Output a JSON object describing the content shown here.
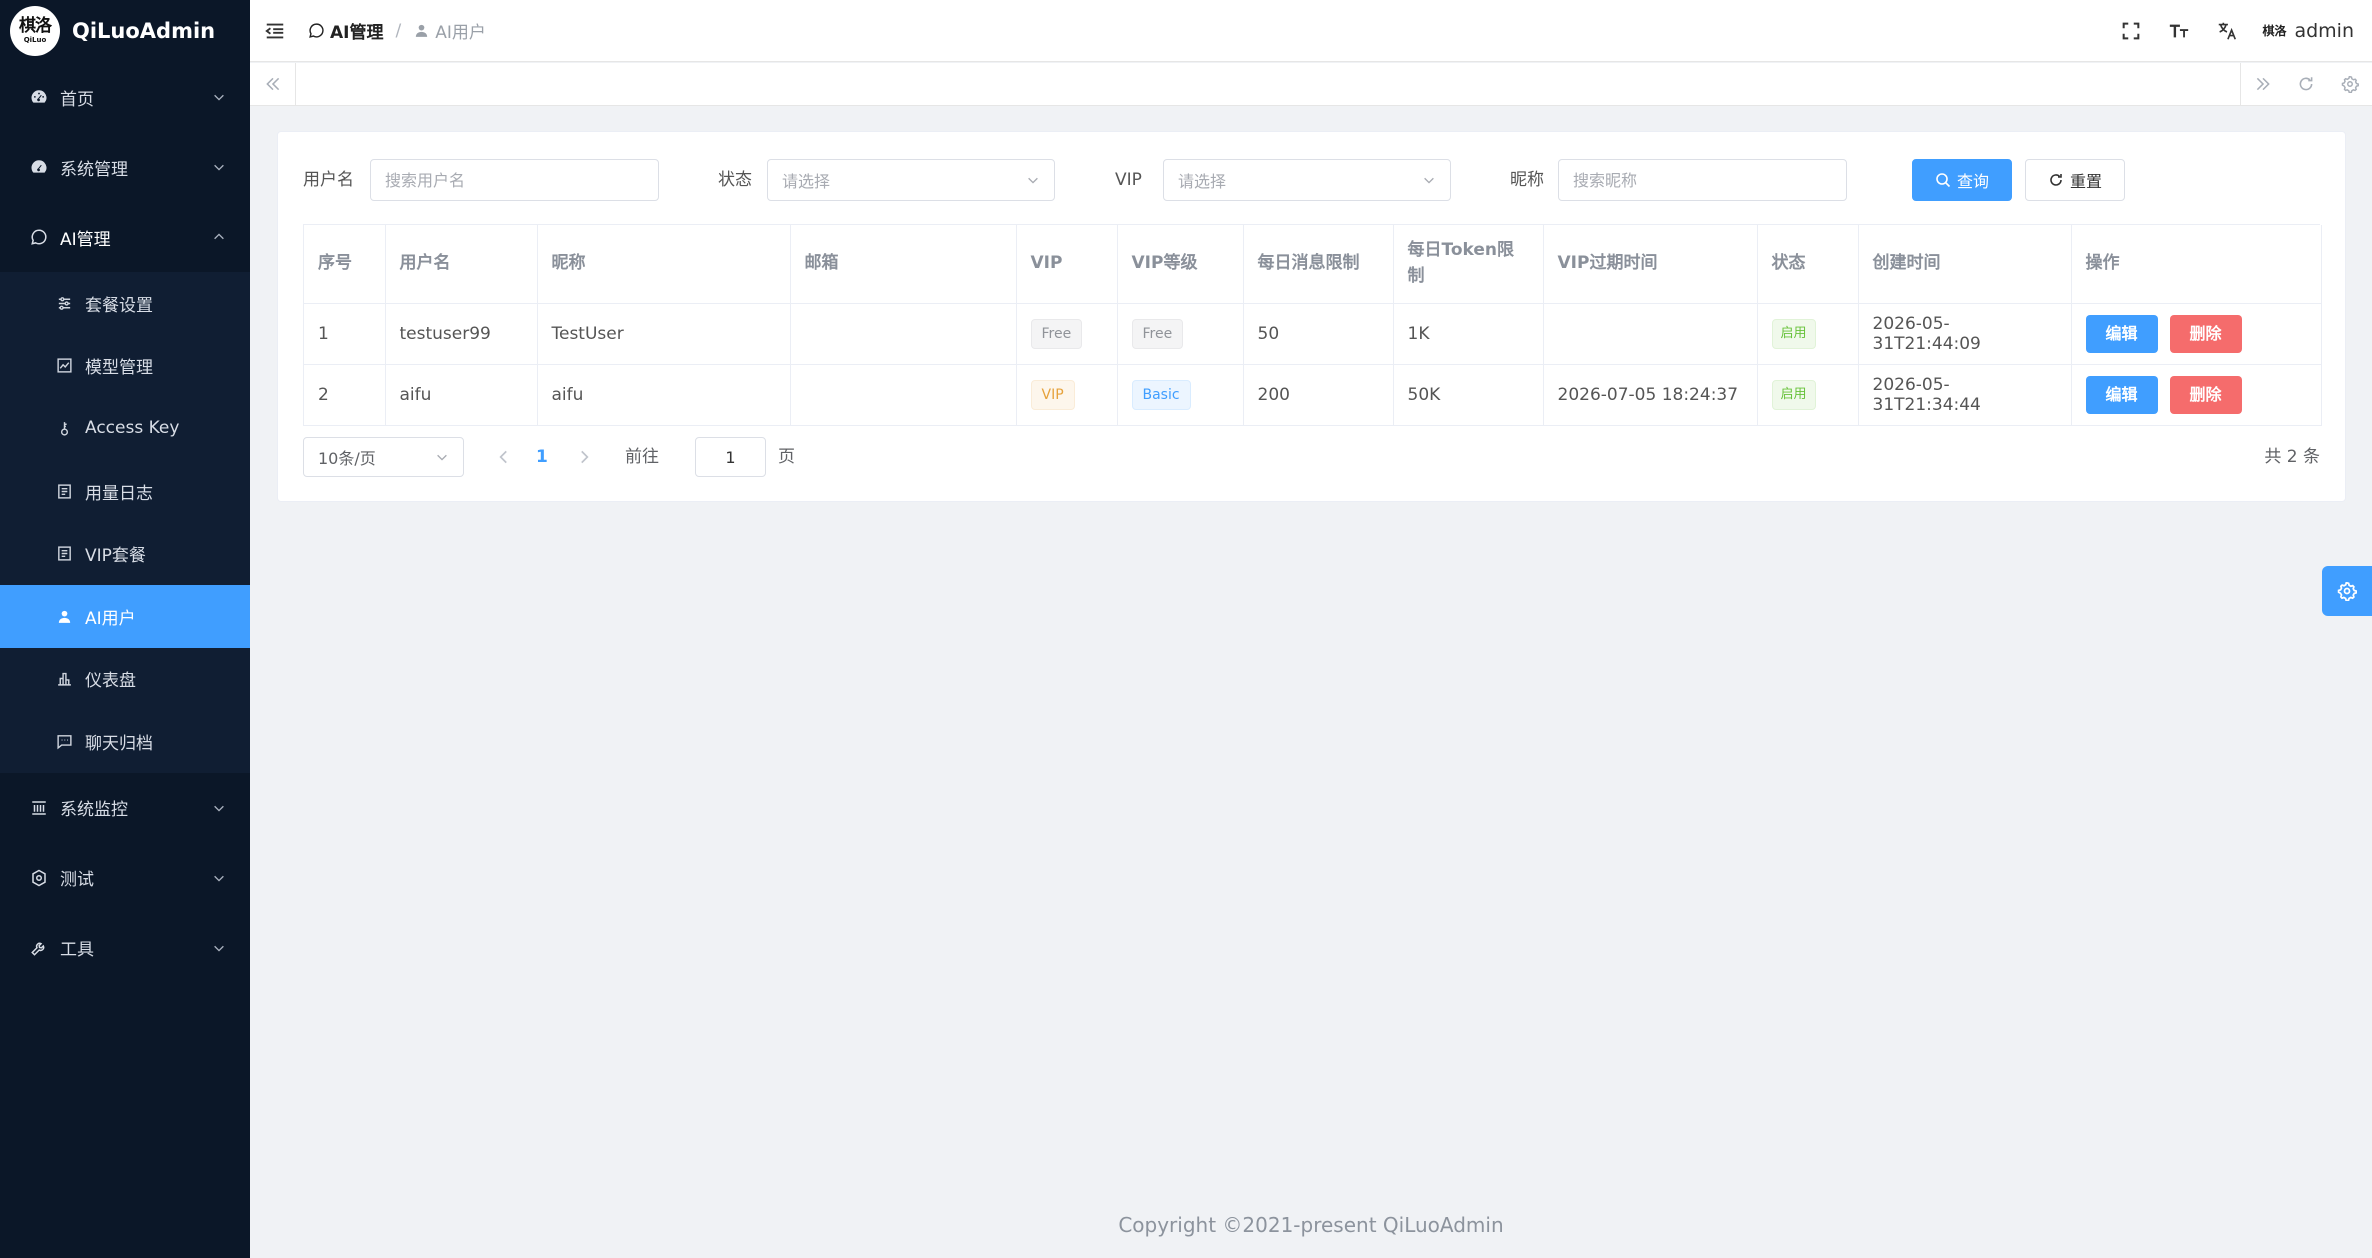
{
  "app": {
    "logo_main": "棋洛",
    "logo_sub": "QiLuo",
    "title": "QiLuoAdmin"
  },
  "sidebar": {
    "items": [
      {
        "label": "首页",
        "icon": "dashboard-icon"
      },
      {
        "label": "系统管理",
        "icon": "gauge-icon"
      },
      {
        "label": "AI管理",
        "icon": "chat-bubble-icon"
      },
      {
        "label": "系统监控",
        "icon": "monitor-icon"
      },
      {
        "label": "测试",
        "icon": "shield-icon"
      },
      {
        "label": "工具",
        "icon": "tools-icon"
      }
    ],
    "ai_submenu": [
      {
        "label": "套餐设置",
        "icon": "sliders-icon"
      },
      {
        "label": "模型管理",
        "icon": "chart-icon"
      },
      {
        "label": "Access Key",
        "icon": "key-icon"
      },
      {
        "label": "用量日志",
        "icon": "document-icon"
      },
      {
        "label": "VIP套餐",
        "icon": "document-icon"
      },
      {
        "label": "AI用户",
        "icon": "user-icon"
      },
      {
        "label": "仪表盘",
        "icon": "bar-chart-icon"
      },
      {
        "label": "聊天归档",
        "icon": "message-icon"
      }
    ],
    "active": "AI用户"
  },
  "header": {
    "breadcrumb": [
      "AI管理",
      "AI用户"
    ],
    "separator": "/",
    "avatar_text": "棋洛",
    "username": "admin"
  },
  "filters": {
    "username_label": "用户名",
    "username_placeholder": "搜索用户名",
    "status_label": "状态",
    "status_placeholder": "请选择",
    "vip_label": "VIP",
    "vip_placeholder": "请选择",
    "nickname_label": "昵称",
    "nickname_placeholder": "搜索昵称",
    "search_label": "查询",
    "reset_label": "重置"
  },
  "table": {
    "columns": [
      "序号",
      "用户名",
      "昵称",
      "邮箱",
      "VIP",
      "VIP等级",
      "每日消息限制",
      "每日Token限制",
      "VIP过期时间",
      "状态",
      "创建时间",
      "操作"
    ],
    "rows": [
      {
        "index": "1",
        "username": "testuser99",
        "nickname": "TestUser",
        "email": "",
        "vip": "Free",
        "vip_level": "Free",
        "daily_msg": "50",
        "daily_token": "1K",
        "vip_expire": "",
        "status": "启用",
        "created": "2026-05-31T21:44:09"
      },
      {
        "index": "2",
        "username": "aifu",
        "nickname": "aifu",
        "email": "",
        "vip": "VIP",
        "vip_level": "Basic",
        "daily_msg": "200",
        "daily_token": "50K",
        "vip_expire": "2026-07-05 18:24:37",
        "status": "启用",
        "created": "2026-05-31T21:34:44"
      }
    ],
    "edit_label": "编辑",
    "delete_label": "删除"
  },
  "pagination": {
    "page_size": "10条/页",
    "current_page": "1",
    "goto_label": "前往",
    "goto_value": "1",
    "page_suffix": "页",
    "total": "共 2 条"
  },
  "footer": {
    "copyright": "Copyright ©2021-present QiLuoAdmin"
  },
  "colors": {
    "sidebar_bg": "#0b1728",
    "primary": "#409eff",
    "danger": "#f56c6c"
  }
}
